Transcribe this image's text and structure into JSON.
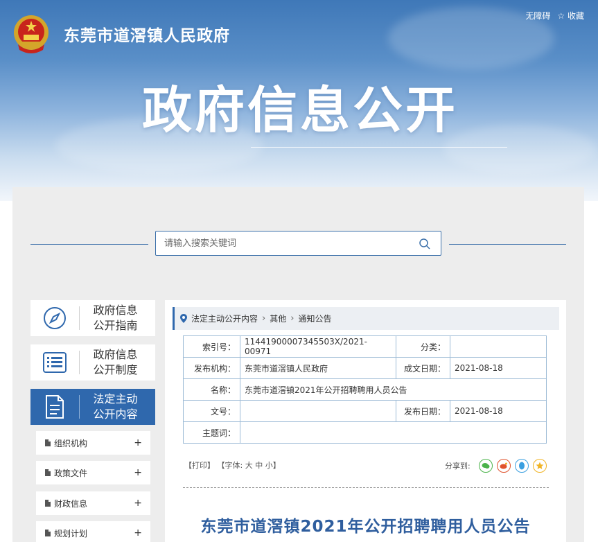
{
  "header": {
    "site_name": "东莞市道滘镇人民政府",
    "top_links": [
      "无障碍",
      "☆ 收藏"
    ],
    "big_title": "政府信息公开"
  },
  "search": {
    "placeholder": "请输入搜索关键词"
  },
  "sidebar": {
    "cards": [
      {
        "label_line1": "政府信息",
        "label_line2": "公开指南",
        "icon": "compass-icon",
        "active": false
      },
      {
        "label_line1": "政府信息",
        "label_line2": "公开制度",
        "icon": "list-icon",
        "active": false
      },
      {
        "label_line1": "法定主动",
        "label_line2": "公开内容",
        "icon": "document-icon",
        "active": true
      }
    ],
    "sub_items": [
      {
        "label": "组织机构",
        "toggle": "+"
      },
      {
        "label": "政策文件",
        "toggle": "+"
      },
      {
        "label": "财政信息",
        "toggle": "+"
      },
      {
        "label": "规划计划",
        "toggle": "+"
      }
    ]
  },
  "breadcrumb": {
    "icon": "location-pin-icon",
    "items": [
      "法定主动公开内容",
      "其他",
      "通知公告"
    ],
    "separator": "›"
  },
  "meta": {
    "index_label": "索引号：",
    "index_value": "11441900007345503X/2021-00971",
    "category_label": "分类：",
    "category_value": "",
    "publisher_label": "发布机构：",
    "publisher_value": "东莞市道滘镇人民政府",
    "created_label": "成文日期：",
    "created_value": "2021-08-18",
    "name_label": "名称：",
    "name_value": "东莞市道滘镇2021年公开招聘聘用人员公告",
    "docno_label": "文号：",
    "docno_value": "",
    "published_label": "发布日期：",
    "published_value": "2021-08-18",
    "keywords_label": "主题词：",
    "keywords_value": ""
  },
  "tools": {
    "print": "【打印】",
    "font_prefix": "【字体:",
    "font_large": "大",
    "font_medium": "中",
    "font_small": "小",
    "font_suffix": "】"
  },
  "share": {
    "label": "分享到:",
    "targets": [
      {
        "name": "wechat-icon",
        "color": "#4bb34b"
      },
      {
        "name": "weibo-icon",
        "color": "#e0522d"
      },
      {
        "name": "qq-icon",
        "color": "#3a9fe0"
      },
      {
        "name": "qzone-icon",
        "color": "#f0b324"
      }
    ]
  },
  "article": {
    "title": "东莞市道滘镇2021年公开招聘聘用人员公告"
  },
  "colors": {
    "primary": "#2f68ad",
    "title_blue": "#2f5e9e",
    "panel_gray": "#ededed"
  }
}
